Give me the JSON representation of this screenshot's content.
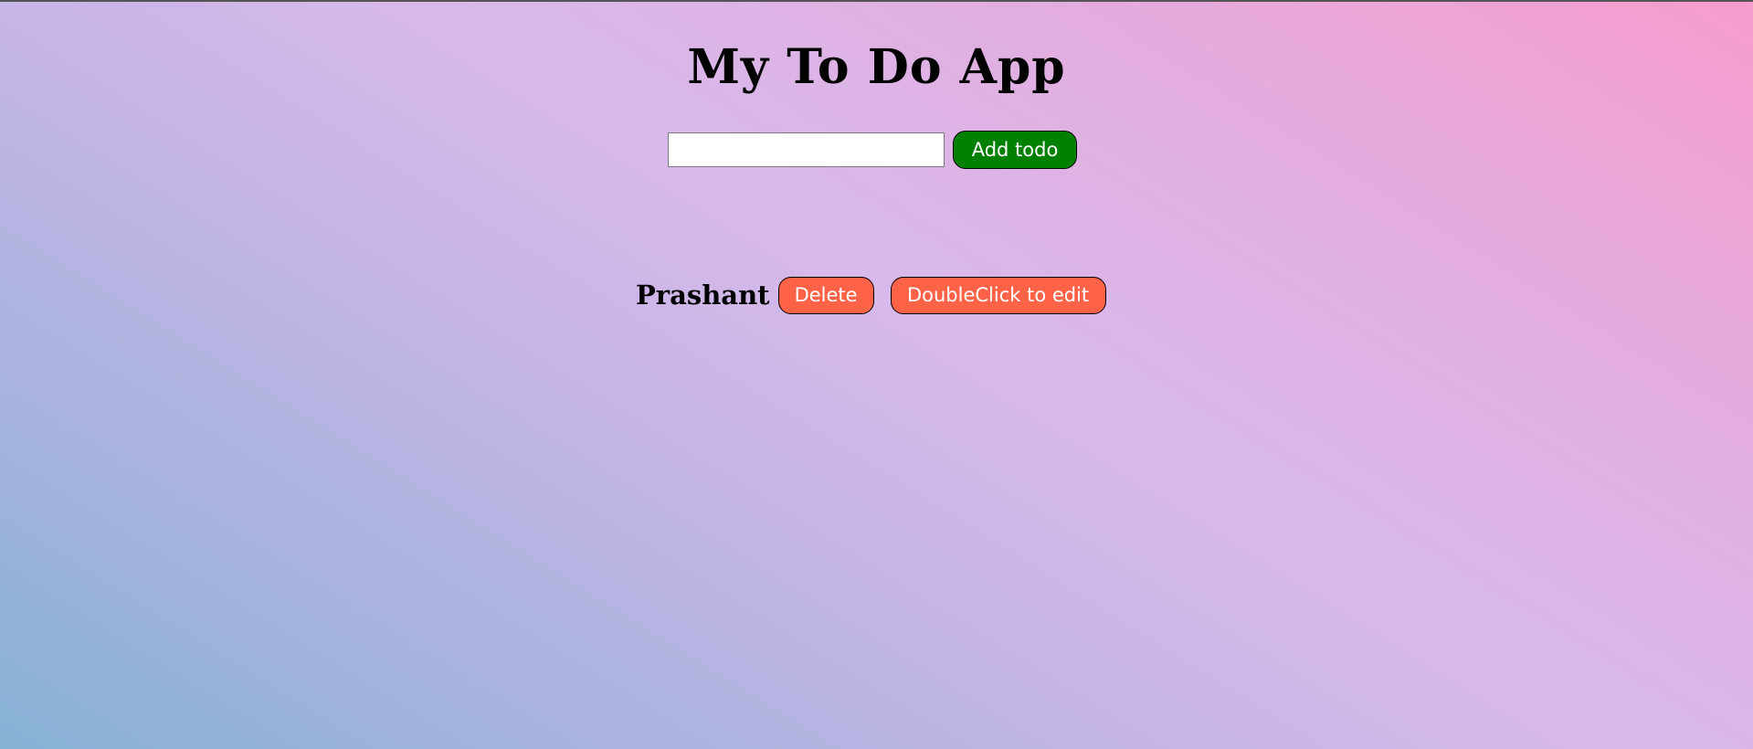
{
  "header": {
    "title": "My To Do App"
  },
  "add_form": {
    "input_value": "",
    "input_placeholder": "",
    "add_button_label": "Add todo",
    "add_button_color": "#008000"
  },
  "todos": [
    {
      "text": "Prashant",
      "delete_label": "Delete",
      "edit_label": "DoubleClick to edit",
      "button_color": "#ff6347"
    }
  ]
}
